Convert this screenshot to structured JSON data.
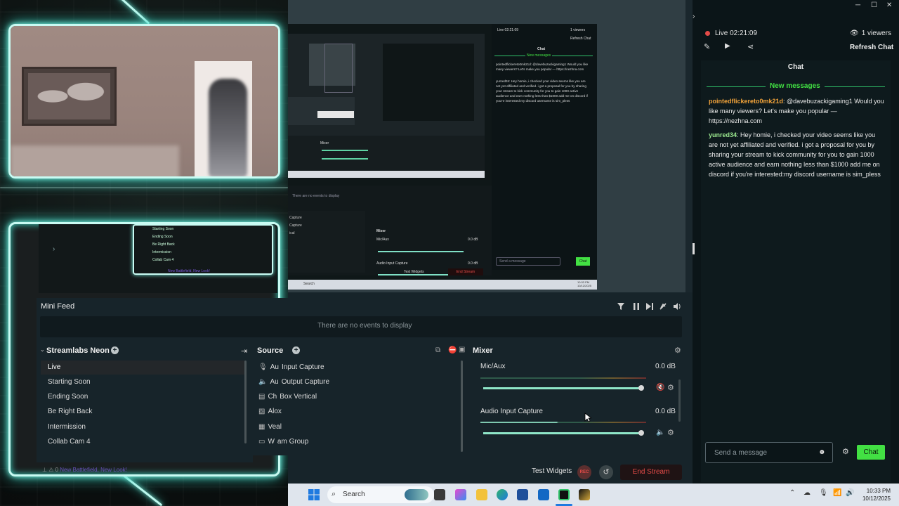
{
  "window_controls": {
    "minimize": "─",
    "maximize": "☐",
    "close": "✕"
  },
  "colors": {
    "neon": "#7ff5e4",
    "accent_green": "#31c36a",
    "chat_button": "#42e043",
    "live_red": "#e34b48",
    "end_stream": "#e34b48"
  },
  "overlay": {
    "scenes_preview": [
      "Starting Soon",
      "Ending Soon",
      "Be Right Back",
      "Intermission",
      "Collab Cam 4"
    ],
    "scenes_preview_bottom": "New Battlefield, New Look!"
  },
  "nested_preview": {
    "no_events": "There are no events to display",
    "mixer_title": "Mixer",
    "mic_label": "Mic/Aux",
    "mic_db": "0.0 dB",
    "audio_label": "Audio Input Capture",
    "audio_db": "0.0 dB",
    "sources": [
      "Capture",
      "Capture",
      "ical"
    ],
    "test_widgets": "Test Widgets",
    "end_stream": "End Stream",
    "taskbar_search": "Search",
    "live": "Live 02:21:09",
    "viewers": "1 viewers",
    "refresh_chat": "Refresh Chat",
    "chat_title": "Chat",
    "new_messages": "New messages",
    "msg1": "pointedflickereto0mk21d: @davebuzackigaming1 Would you like many viewers? Let's make you popular — https://nezhna.com",
    "msg2": "yunred34: Hey homie, i checked your video seems like you are not yet affiliated and verified. i got a proposal for you by sharing your stream to kick community for you to gain 1000 active audience and earn nothing less than $1000 add me on discord if you're interested:my discord username is sim_pless",
    "send_placeholder": "Send a message",
    "chat_button": "Chat",
    "clock_time": "10:33 PM",
    "clock_date": "10/12/2025"
  },
  "mini_feed": {
    "title": "Mini Feed",
    "empty": "There are no events to display"
  },
  "scenes": {
    "collection": "Streamlabs Neon",
    "items": [
      "Live",
      "Starting Soon",
      "Ending Soon",
      "Be Right Back",
      "Intermission",
      "Collab Cam 4"
    ],
    "bottom_peek": "New Battlefield, New Look!"
  },
  "sources": {
    "title": "Sources",
    "title_visible": "Source",
    "items": [
      "Au",
      "Au",
      "Ch",
      "Al",
      "Ve",
      "W"
    ],
    "items_rest": [
      "Input Capture",
      "Output Capture",
      "Box Vertical",
      "ox",
      "al",
      "am Group"
    ]
  },
  "mixer": {
    "title": "Mixer",
    "channels": [
      {
        "name": "Mic/Aux",
        "db": "0.0 dB",
        "volume": 0.985
      },
      {
        "name": "Audio Input Capture",
        "db": "0.0 dB",
        "volume": 0.985
      }
    ]
  },
  "footer": {
    "test_widgets": "Test Widgets",
    "rec": "REC",
    "end_stream": "End Stream"
  },
  "chat": {
    "live_label": "Live 02:21:09",
    "viewers": "1 viewers",
    "refresh": "Refresh Chat",
    "title": "Chat",
    "new_messages": "New messages",
    "messages": [
      {
        "user": "pointedflickereto0mk21d",
        "user_color": "#f2a33a",
        "text": ": @davebuzackigaming1 Would you like many viewers? Let's make you popular — https://nezhna.com"
      },
      {
        "user": "yunred34",
        "user_color": "#9be88f",
        "text": ": Hey homie, i checked your video seems like you are not yet affiliated and verified. i got a proposal for you by sharing your stream to kick community for you to gain 1000 active audience and earn nothing less than $1000 add me on discord if you're interested:my discord username is sim_pless"
      }
    ],
    "input_placeholder": "Send a message",
    "send_button": "Chat"
  },
  "taskbar": {
    "search_placeholder": "Search",
    "time": "10:33 PM",
    "date": "10/12/2025"
  }
}
